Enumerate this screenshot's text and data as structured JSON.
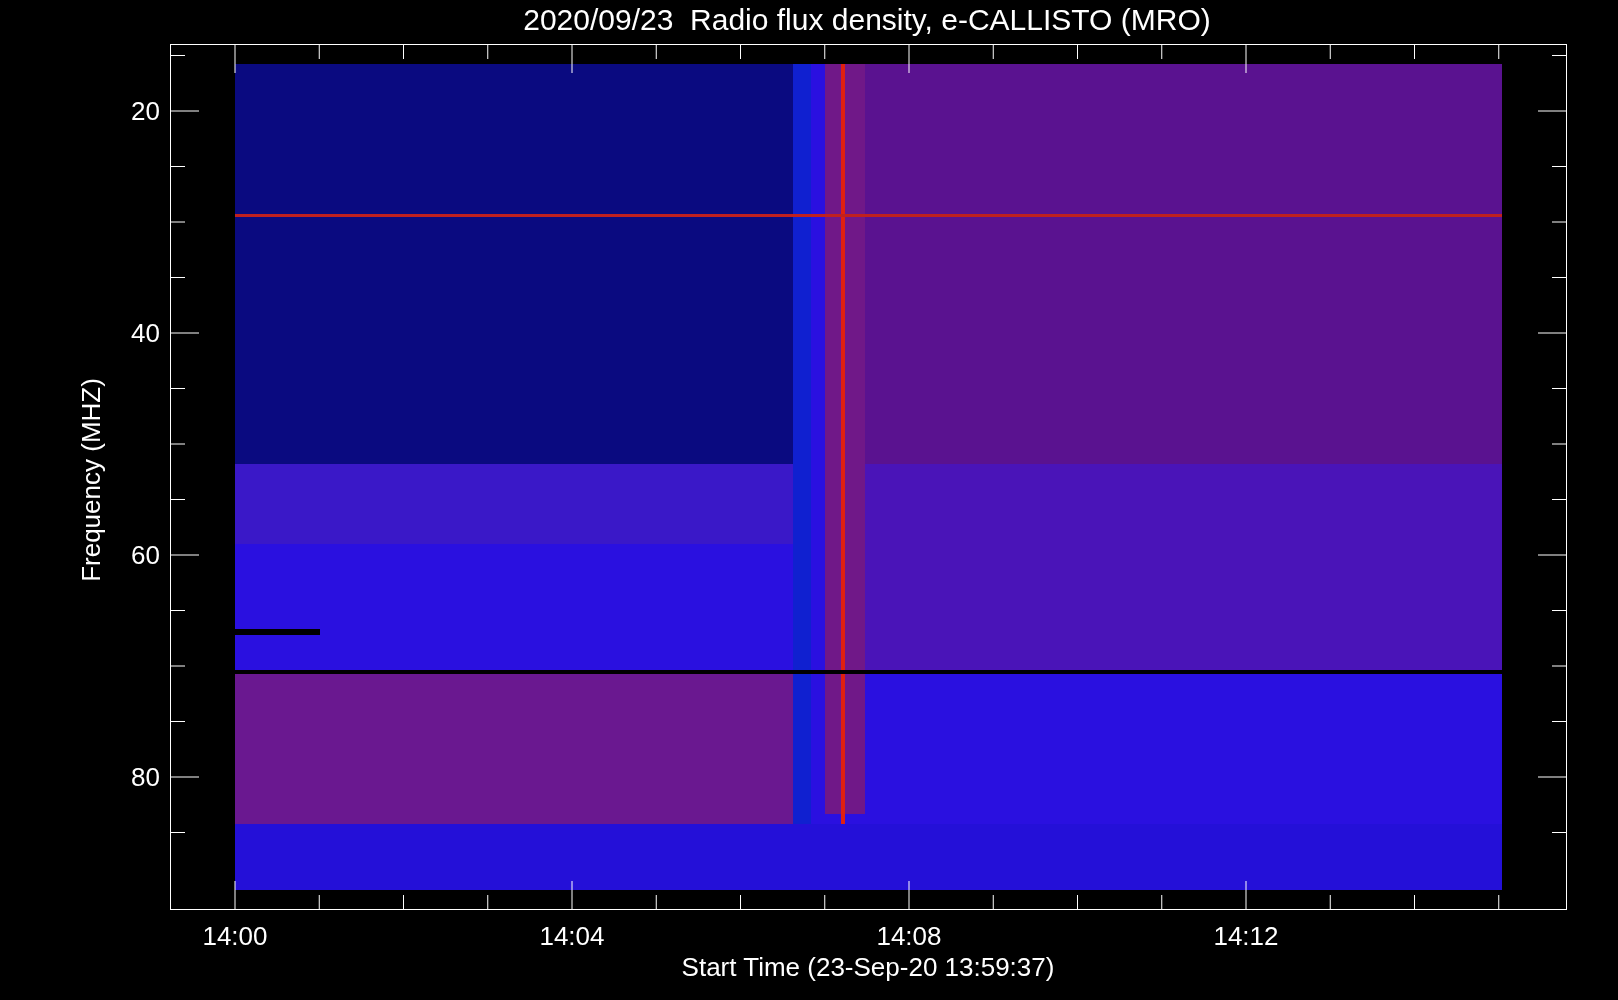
{
  "title": "2020/09/23  Radio flux density, e-CALLISTO (MRO)",
  "ylabel": "Frequency (MHZ)",
  "xlabel": "Start Time (23-Sep-20 13:59:37)",
  "yticks": [
    "20",
    "40",
    "60",
    "80"
  ],
  "xticks": [
    "14:00",
    "14:04",
    "14:08",
    "14:12"
  ]
}
